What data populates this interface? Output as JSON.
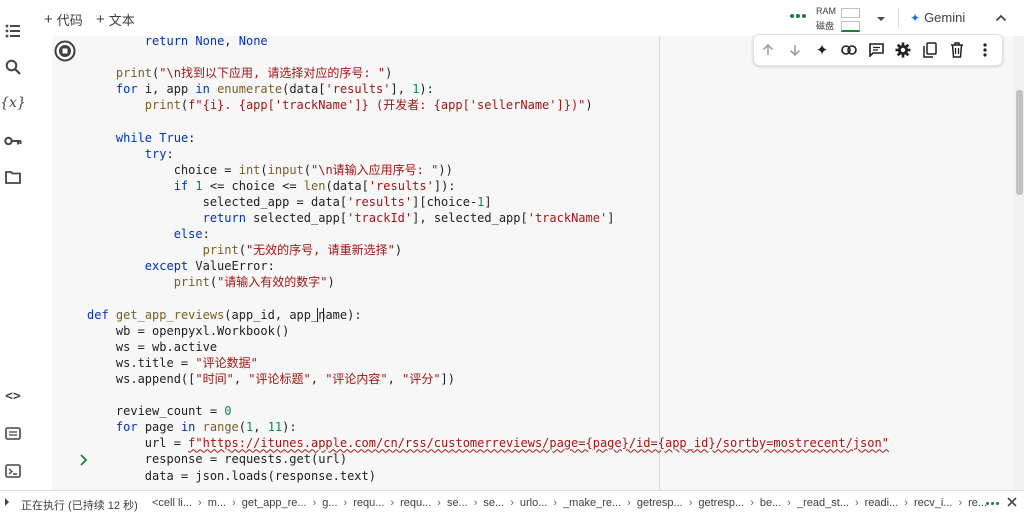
{
  "toolbar": {
    "add_code": "代码",
    "add_text": "文本",
    "ram_label": "RAM",
    "disk_label": "磁盘",
    "gemini_label": "Gemini"
  },
  "code_lines": [
    "        return None, None",
    "",
    "    print(\"\\n找到以下应用, 请选择对应的序号: \")",
    "    for i, app in enumerate(data['results'], 1):",
    "        print(f\"{i}. {app['trackName']} (开发者: {app['sellerName']})\")",
    "",
    "    while True:",
    "        try:",
    "            choice = int(input(\"\\n请输入应用序号: \"))",
    "            if 1 <= choice <= len(data['results']):",
    "                selected_app = data['results'][choice-1]",
    "                return selected_app['trackId'], selected_app['trackName']",
    "            else:",
    "                print(\"无效的序号, 请重新选择\")",
    "        except ValueError:",
    "            print(\"请输入有效的数字\")",
    "",
    "def get_app_reviews(app_id, app_name):",
    "    wb = openpyxl.Workbook()",
    "    ws = wb.active",
    "    ws.title = \"评论数据\"",
    "    ws.append([\"时间\", \"评论标题\", \"评论内容\", \"评分\"])",
    "",
    "    review_count = 0",
    "    for page in range(1, 11):",
    "        url = f\"https://itunes.apple.com/cn/rss/customerreviews/page={page}/id={app_id}/sortby=mostrecent/json\"",
    "        response = requests.get(url)",
    "        data = json.loads(response.text)"
  ],
  "status": {
    "executing": "正在执行 (已持续 12 秒)",
    "trace": [
      "<cell li...",
      "m...",
      "get_app_re...",
      "g...",
      "requ...",
      "requ...",
      "se...",
      "se...",
      "urlo...",
      "_make_re...",
      "getresp...",
      "getresp...",
      "be...",
      "_read_st...",
      "readi...",
      "recv_i...",
      "re..."
    ]
  },
  "icons": {
    "rail": [
      "toc-icon",
      "search-icon",
      "variables-icon",
      "key-icon",
      "folder-icon",
      "code-snippets-icon",
      "command-palette-icon",
      "terminal-icon"
    ],
    "cell_toolbar": [
      "move-up-icon",
      "move-down-icon",
      "gemini-sparkle-icon",
      "link-icon",
      "comment-icon",
      "settings-gear-icon",
      "mirror-cell-icon",
      "delete-icon",
      "more-vert-icon"
    ]
  },
  "colors": {
    "keyword": "#0033b3",
    "string": "#a31515",
    "accent": "#1a73e8"
  }
}
